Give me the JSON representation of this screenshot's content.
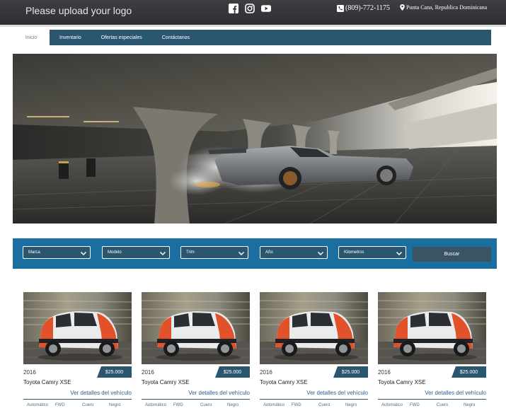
{
  "header": {
    "logo_text": "Please upload your logo",
    "phone": "(809)-772-1175",
    "location": "Punta Cana, Republica Dominicana",
    "social_icons": [
      "facebook-icon",
      "instagram-icon",
      "youtube-icon"
    ]
  },
  "nav": {
    "items": [
      "Inicio",
      "Inventario",
      "Ofertas especiales",
      "Contáctanos"
    ],
    "active": "Inicio"
  },
  "filters": {
    "selects": [
      "Marca",
      "Modelo",
      "Trim",
      "Año",
      "Kilometros"
    ],
    "search_label": "Buscar"
  },
  "listings": [
    {
      "year": "2016",
      "price": "$25.000",
      "title": "Toyota Camry XSE",
      "link": "Ver detalles del vehículo",
      "specs": [
        "Automático",
        "FWD",
        "Cuero",
        "Negro"
      ]
    },
    {
      "year": "2016",
      "price": "$25.000",
      "title": "Toyota Camry XSE",
      "link": "Ver detalles del vehículo",
      "specs": [
        "Automático",
        "FWD",
        "Cuero",
        "Negro"
      ]
    },
    {
      "year": "2016",
      "price": "$25.000",
      "title": "Toyota Camry XSE",
      "link": "Ver detalles del vehículo",
      "specs": [
        "Automático",
        "FWD",
        "Cuero",
        "Negro"
      ]
    },
    {
      "year": "2016",
      "price": "$25.000",
      "title": "Toyota Camry XSE",
      "link": "Ver detalles del vehículo",
      "specs": [
        "Automático",
        "FWD",
        "Cuero",
        "Negro"
      ]
    }
  ],
  "colors": {
    "topbar": "#2c2e31",
    "nav": "#2a5670",
    "filterbar": "#1b6ea0",
    "link": "#2a5c8e"
  }
}
